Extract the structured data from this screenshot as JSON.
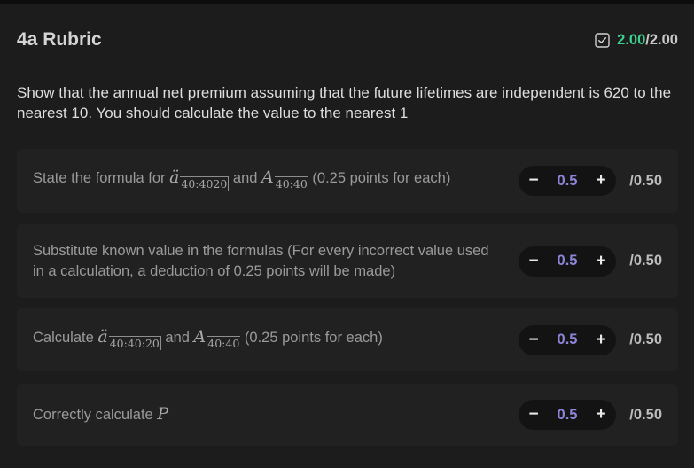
{
  "header": {
    "title": "4a Rubric",
    "score_earned": "2.00",
    "score_separator": "/",
    "score_max": "2.00"
  },
  "question": {
    "text": "Show that the annual net premium assuming that the future lifetimes are independent is 620 to the nearest 10. You should calculate the value to the nearest 1"
  },
  "criteria": [
    {
      "prefix": "State the formula for ",
      "math1": "ä",
      "math1_sub": "40:4020",
      "mid": " and ",
      "math2": "A",
      "math2_sub": "40:40",
      "suffix": " (0.25 points for each)",
      "value": "0.5",
      "max": "/0.50"
    },
    {
      "text": "Substitute known value in the formulas (For every incorrect value used in a calculation, a deduction of 0.25 points will be made)",
      "value": "0.5",
      "max": "/0.50"
    },
    {
      "prefix": "Calculate ",
      "math1": "ä",
      "math1_sub": "40:40:20",
      "mid": " and ",
      "math2": "A",
      "math2_sub": "40:40",
      "suffix": " (0.25 points for each)",
      "value": "0.5",
      "max": "/0.50"
    },
    {
      "prefix": "Correctly calculate ",
      "math1": "P",
      "value": "0.5",
      "max": "/0.50"
    }
  ],
  "controls": {
    "decrement_symbol": "−",
    "increment_symbol": "+"
  },
  "colors": {
    "score_earned": "#3fcf8e",
    "stepper_value": "#8d86d8",
    "card_background": "#212122"
  },
  "icons": {
    "score": "checkbox-checked-icon"
  }
}
